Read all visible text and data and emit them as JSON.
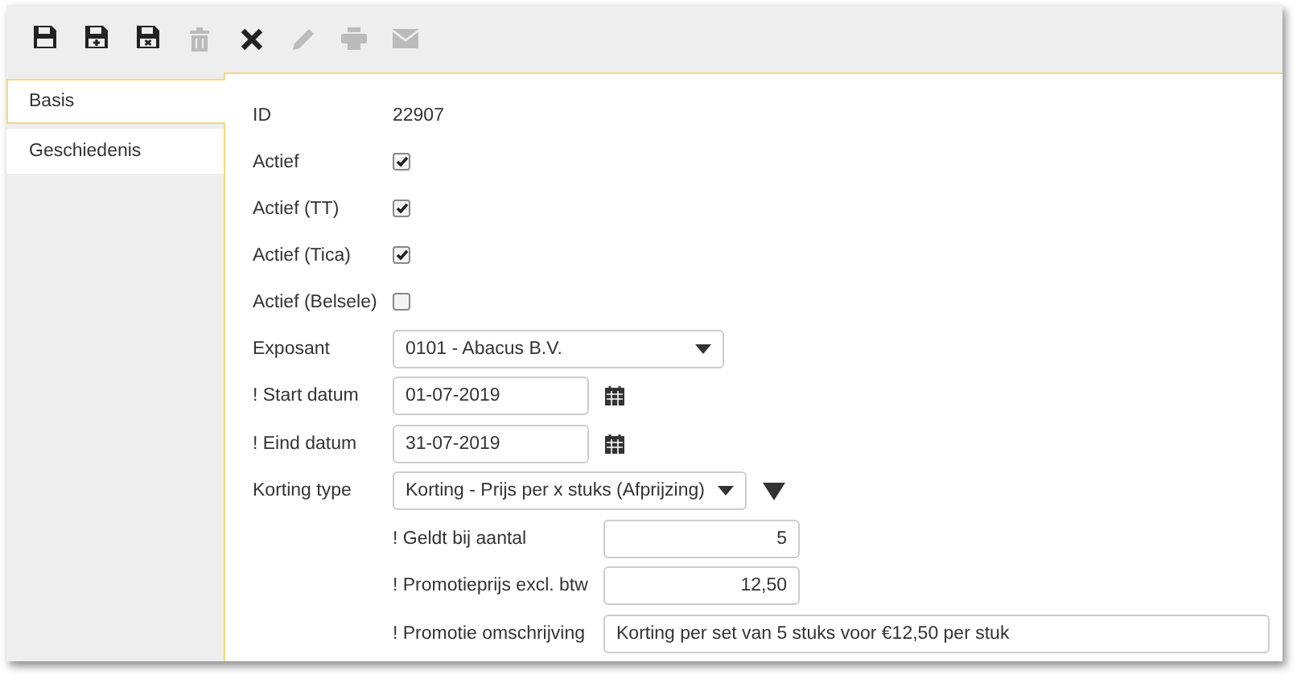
{
  "toolbar": [
    {
      "kind": "save",
      "disabled": false
    },
    {
      "kind": "save-new",
      "disabled": false
    },
    {
      "kind": "save-close",
      "disabled": false
    },
    {
      "kind": "delete",
      "disabled": true
    },
    {
      "kind": "cancel",
      "disabled": false
    },
    {
      "kind": "edit",
      "disabled": true
    },
    {
      "kind": "print",
      "disabled": true
    },
    {
      "kind": "mail",
      "disabled": true
    }
  ],
  "tabs": [
    {
      "label": "Basis",
      "selected": true
    },
    {
      "label": "Geschiedenis",
      "selected": false
    }
  ],
  "fields": [
    {
      "kind": "text",
      "label": "ID",
      "value": "22907"
    },
    {
      "kind": "checkbox",
      "label": "Actief",
      "checked": true
    },
    {
      "kind": "checkbox",
      "label": "Actief (TT)",
      "checked": true
    },
    {
      "kind": "checkbox",
      "label": "Actief (Tica)",
      "checked": true
    },
    {
      "kind": "checkbox",
      "label": "Actief (Belsele)",
      "checked": false
    },
    {
      "kind": "select",
      "label": "Exposant",
      "value": "0101 - Abacus B.V.",
      "filter": false
    },
    {
      "kind": "date",
      "label": "! Start datum",
      "value": "01-07-2019"
    },
    {
      "kind": "date",
      "label": "! Eind datum",
      "value": "31-07-2019"
    },
    {
      "kind": "select",
      "label": "Korting type",
      "value": "Korting - Prijs per x stuks (Afprijzing)",
      "filter": true,
      "children": [
        {
          "kind": "number",
          "label": "! Geldt bij aantal",
          "value": "5"
        },
        {
          "kind": "number",
          "label": "! Promotieprijs excl. btw",
          "value": "12,50"
        },
        {
          "kind": "wide",
          "label": "! Promotie omschrijving",
          "value": "Korting per set van 5 stuks voor €12,50 per stuk"
        }
      ]
    }
  ]
}
